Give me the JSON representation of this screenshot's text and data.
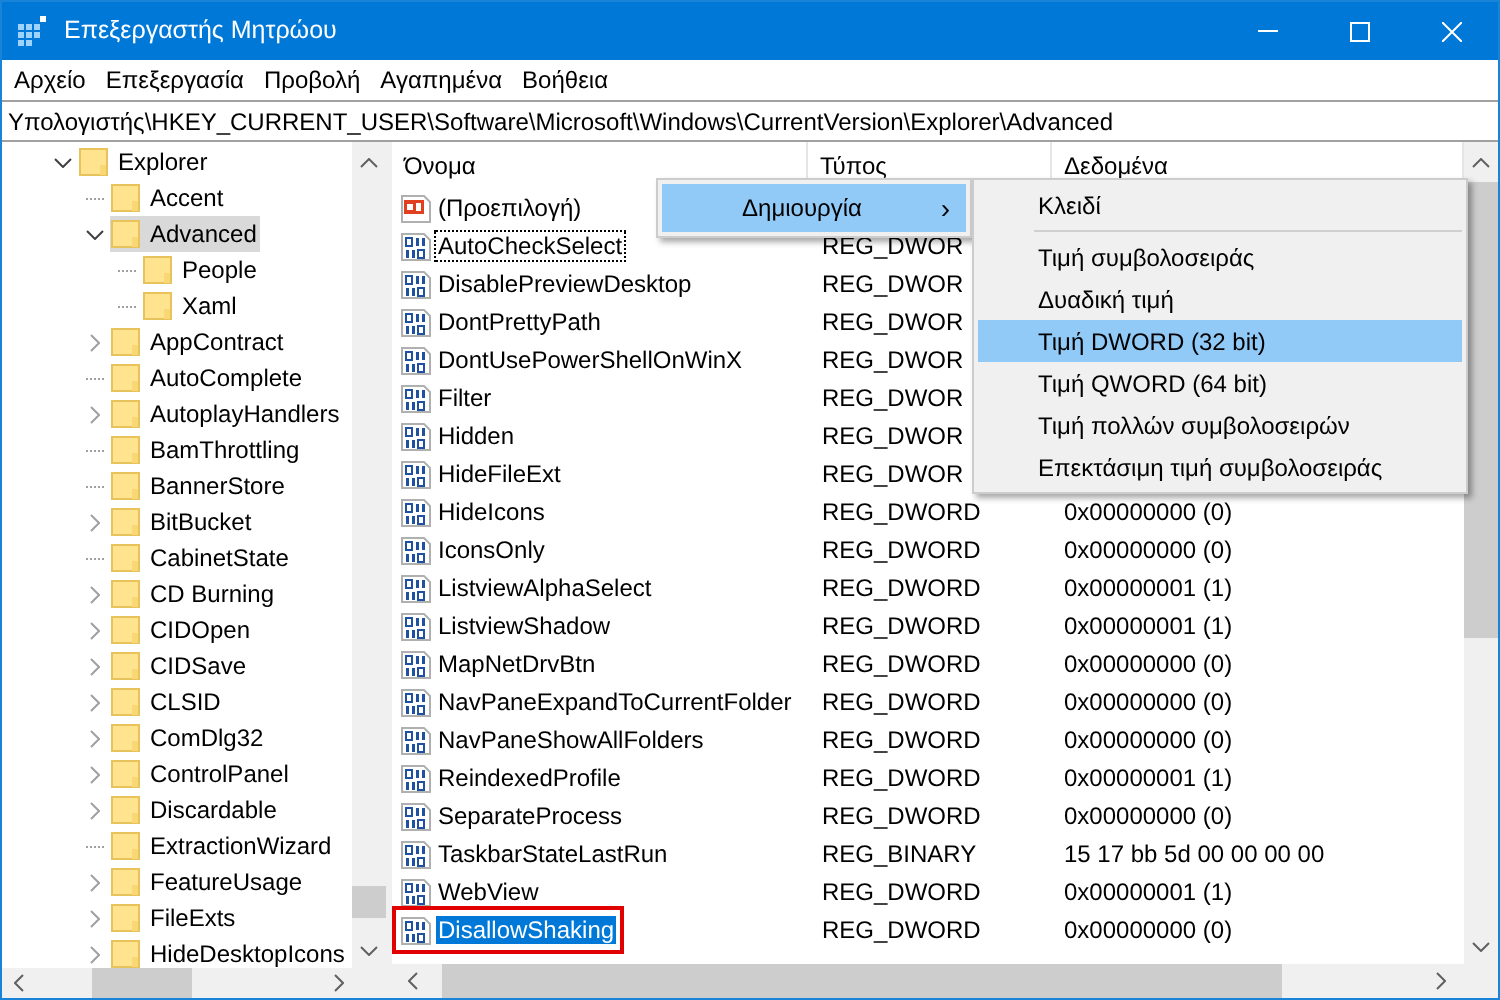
{
  "window": {
    "title": "Επεξεργαστής Μητρώου"
  },
  "menu": [
    "Αρχείο",
    "Επεξεργασία",
    "Προβολή",
    "Αγαπημένα",
    "Βοήθεια"
  ],
  "address": "Υπολογιστής\\HKEY_CURRENT_USER\\Software\\Microsoft\\Windows\\CurrentVersion\\Explorer\\Advanced",
  "tree": [
    {
      "label": "Explorer",
      "expanded": true,
      "selected": false,
      "children": [
        {
          "label": "Accent",
          "has_children": false,
          "expanded": false,
          "selected": false
        },
        {
          "label": "Advanced",
          "expanded": true,
          "selected": true,
          "children": [
            {
              "label": "People",
              "has_children": false,
              "expanded": false,
              "selected": false
            },
            {
              "label": "Xaml",
              "has_children": false,
              "expanded": false,
              "selected": false
            }
          ]
        },
        {
          "label": "AppContract",
          "has_children": true,
          "expanded": false,
          "selected": false
        },
        {
          "label": "AutoComplete",
          "has_children": false,
          "expanded": false,
          "selected": false
        },
        {
          "label": "AutoplayHandlers",
          "has_children": true,
          "expanded": false,
          "selected": false
        },
        {
          "label": "BamThrottling",
          "has_children": false,
          "expanded": false,
          "selected": false
        },
        {
          "label": "BannerStore",
          "has_children": false,
          "expanded": false,
          "selected": false
        },
        {
          "label": "BitBucket",
          "has_children": true,
          "expanded": false,
          "selected": false
        },
        {
          "label": "CabinetState",
          "has_children": false,
          "expanded": false,
          "selected": false
        },
        {
          "label": "CD Burning",
          "has_children": true,
          "expanded": false,
          "selected": false
        },
        {
          "label": "CIDOpen",
          "has_children": true,
          "expanded": false,
          "selected": false
        },
        {
          "label": "CIDSave",
          "has_children": true,
          "expanded": false,
          "selected": false
        },
        {
          "label": "CLSID",
          "has_children": true,
          "expanded": false,
          "selected": false
        },
        {
          "label": "ComDlg32",
          "has_children": true,
          "expanded": false,
          "selected": false
        },
        {
          "label": "ControlPanel",
          "has_children": true,
          "expanded": false,
          "selected": false
        },
        {
          "label": "Discardable",
          "has_children": true,
          "expanded": false,
          "selected": false
        },
        {
          "label": "ExtractionWizard",
          "has_children": false,
          "expanded": false,
          "selected": false
        },
        {
          "label": "FeatureUsage",
          "has_children": true,
          "expanded": false,
          "selected": false
        },
        {
          "label": "FileExts",
          "has_children": true,
          "expanded": false,
          "selected": false
        },
        {
          "label": "HideDesktopIcons",
          "has_children": true,
          "expanded": false,
          "selected": false
        }
      ]
    }
  ],
  "table": {
    "columns": [
      "Όνομα",
      "Τύπος",
      "Δεδομένα"
    ],
    "rows": [
      {
        "kind": "string",
        "name": "(Προεπιλογή)",
        "selected": false,
        "focused": false,
        "outlined": false
      },
      {
        "kind": "dword",
        "name": "AutoCheckSelect",
        "type": "REG_DWOR",
        "selected": false,
        "focused": true,
        "outlined": false
      },
      {
        "kind": "dword",
        "name": "DisablePreviewDesktop",
        "type": "REG_DWOR",
        "selected": false,
        "focused": false,
        "outlined": false
      },
      {
        "kind": "dword",
        "name": "DontPrettyPath",
        "type": "REG_DWOR",
        "selected": false,
        "focused": false,
        "outlined": false
      },
      {
        "kind": "dword",
        "name": "DontUsePowerShellOnWinX",
        "type": "REG_DWOR",
        "selected": false,
        "focused": false,
        "outlined": false
      },
      {
        "kind": "dword",
        "name": "Filter",
        "type": "REG_DWOR",
        "selected": false,
        "focused": false,
        "outlined": false
      },
      {
        "kind": "dword",
        "name": "Hidden",
        "type": "REG_DWOR",
        "selected": false,
        "focused": false,
        "outlined": false
      },
      {
        "kind": "dword",
        "name": "HideFileExt",
        "type": "REG_DWOR",
        "selected": false,
        "focused": false,
        "outlined": false
      },
      {
        "kind": "dword",
        "name": "HideIcons",
        "type": "REG_DWORD",
        "data": "0x00000000 (0)",
        "selected": false,
        "focused": false,
        "outlined": false
      },
      {
        "kind": "dword",
        "name": "IconsOnly",
        "type": "REG_DWORD",
        "data": "0x00000000 (0)",
        "selected": false,
        "focused": false,
        "outlined": false
      },
      {
        "kind": "dword",
        "name": "ListviewAlphaSelect",
        "type": "REG_DWORD",
        "data": "0x00000001 (1)",
        "selected": false,
        "focused": false,
        "outlined": false
      },
      {
        "kind": "dword",
        "name": "ListviewShadow",
        "type": "REG_DWORD",
        "data": "0x00000001 (1)",
        "selected": false,
        "focused": false,
        "outlined": false
      },
      {
        "kind": "dword",
        "name": "MapNetDrvBtn",
        "type": "REG_DWORD",
        "data": "0x00000000 (0)",
        "selected": false,
        "focused": false,
        "outlined": false
      },
      {
        "kind": "dword",
        "name": "NavPaneExpandToCurrentFolder",
        "type": "REG_DWORD",
        "data": "0x00000000 (0)",
        "selected": false,
        "focused": false,
        "outlined": false
      },
      {
        "kind": "dword",
        "name": "NavPaneShowAllFolders",
        "type": "REG_DWORD",
        "data": "0x00000000 (0)",
        "selected": false,
        "focused": false,
        "outlined": false
      },
      {
        "kind": "dword",
        "name": "ReindexedProfile",
        "type": "REG_DWORD",
        "data": "0x00000001 (1)",
        "selected": false,
        "focused": false,
        "outlined": false
      },
      {
        "kind": "dword",
        "name": "SeparateProcess",
        "type": "REG_DWORD",
        "data": "0x00000000 (0)",
        "selected": false,
        "focused": false,
        "outlined": false
      },
      {
        "kind": "binary",
        "name": "TaskbarStateLastRun",
        "type": "REG_BINARY",
        "data": "15 17 bb 5d 00 00 00 00",
        "selected": false,
        "focused": false,
        "outlined": false
      },
      {
        "kind": "dword",
        "name": "WebView",
        "type": "REG_DWORD",
        "data": "0x00000001 (1)",
        "selected": false,
        "focused": false,
        "outlined": false
      },
      {
        "kind": "dword",
        "name": "DisallowShaking",
        "type": "REG_DWORD",
        "data": "0x00000000 (0)",
        "selected": true,
        "focused": false,
        "outlined": true
      }
    ]
  },
  "context_menu": {
    "items": [
      {
        "label": "Δημιουργία",
        "arrow": "›",
        "selected": true
      }
    ]
  },
  "submenu": {
    "items": [
      {
        "kind": "item",
        "label": "Κλειδί",
        "selected": false
      },
      {
        "kind": "separator"
      },
      {
        "kind": "item",
        "label": "Τιμή συμβολοσειράς",
        "selected": false
      },
      {
        "kind": "item",
        "label": "Δυαδική τιμή",
        "selected": false
      },
      {
        "kind": "item",
        "label": "Τιμή DWORD (32 bit)",
        "selected": true
      },
      {
        "kind": "item",
        "label": "Τιμή QWORD (64 bit)",
        "selected": false
      },
      {
        "kind": "item",
        "label": "Τιμή πολλών συμβολοσειρών",
        "selected": false
      },
      {
        "kind": "item",
        "label": "Επεκτάσιμη τιμή συμβολοσειράς",
        "selected": false
      }
    ]
  }
}
